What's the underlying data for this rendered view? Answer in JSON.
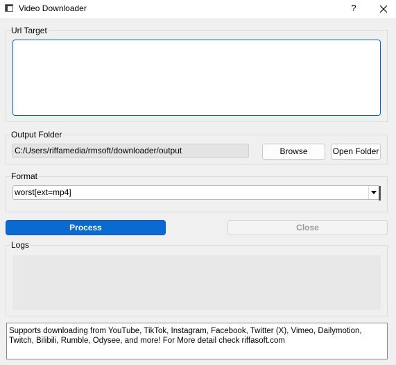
{
  "window": {
    "title": "Video Downloader",
    "help_label": "?",
    "close_icon": "close-icon"
  },
  "url_group": {
    "label": "Url Target",
    "value": ""
  },
  "output_group": {
    "label": "Output Folder",
    "path": "C:/Users/riffamedia/rmsoft/downloader/output",
    "browse_label": "Browse",
    "open_folder_label": "Open Folder"
  },
  "format_group": {
    "label": "Format",
    "selected": "worst[ext=mp4]"
  },
  "actions": {
    "process_label": "Process",
    "close_label": "Close",
    "accent_color": "#0b6ad1"
  },
  "logs_group": {
    "label": "Logs",
    "content": ""
  },
  "info": {
    "text": "Supports downloading from YouTube, TikTok, Instagram, Facebook, Twitter (X), Vimeo, Dailymotion, Twitch, Bilibili, Rumble, Odysee, and more! For More detail check riffasoft.com"
  }
}
